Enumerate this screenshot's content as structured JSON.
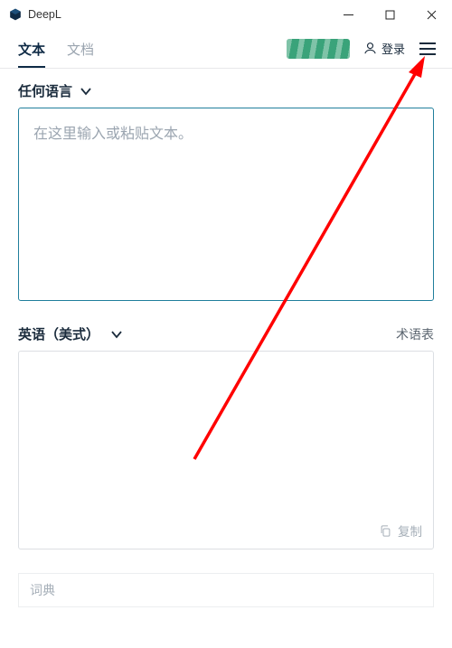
{
  "app": {
    "title": "DeepL"
  },
  "toolbar": {
    "tabs": {
      "text": "文本",
      "doc": "文档"
    },
    "login_label": "登录"
  },
  "source": {
    "lang_label": "任何语言",
    "placeholder": "在这里输入或粘贴文本。",
    "value": ""
  },
  "target": {
    "lang_label": "英语（美式）",
    "glossary_label": "术语表",
    "copy_label": "复制"
  },
  "dictionary": {
    "label": "词典"
  },
  "colors": {
    "accent": "#207e9c",
    "brand_green": "#3aa37a",
    "arrow_red": "#ff0000"
  }
}
